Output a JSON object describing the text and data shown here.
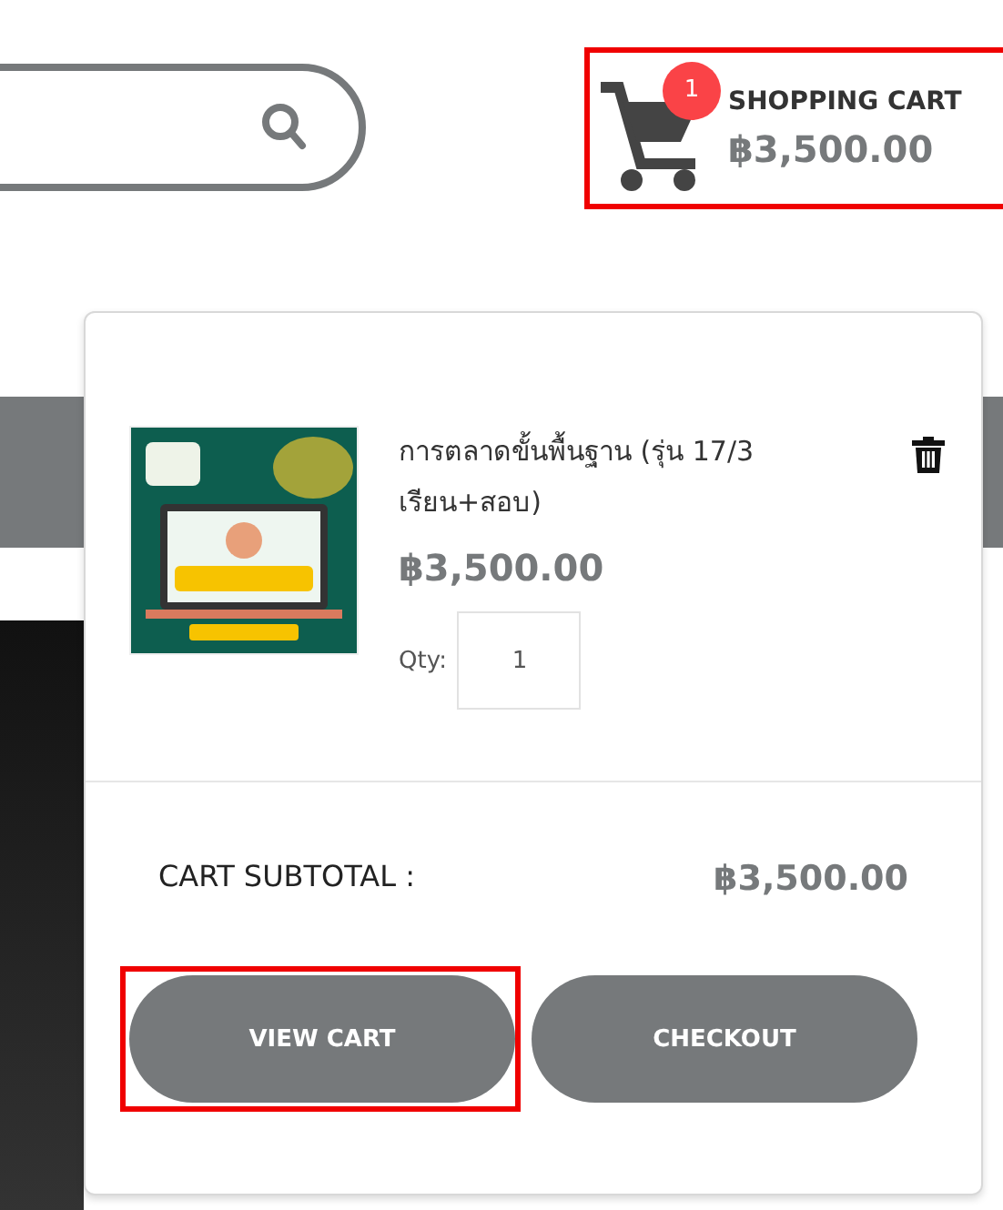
{
  "search": {
    "kind": "search"
  },
  "cart": {
    "title": "SHOPPING CART",
    "total": "฿3,500.00",
    "count": "1",
    "highlighted": true
  },
  "dropdown": {
    "items": [
      {
        "name": "การตลาดขั้นพื้นฐาน (รุ่น 17/3 เรียน+สอบ)",
        "price": "฿3,500.00",
        "qty_label": "Qty:",
        "qty": "1"
      }
    ],
    "subtotal_label": "CART SUBTOTAL :",
    "subtotal": "฿3,500.00",
    "buttons": [
      {
        "label": "VIEW CART",
        "highlighted": true
      },
      {
        "label": "CHECKOUT",
        "highlighted": false
      }
    ]
  }
}
